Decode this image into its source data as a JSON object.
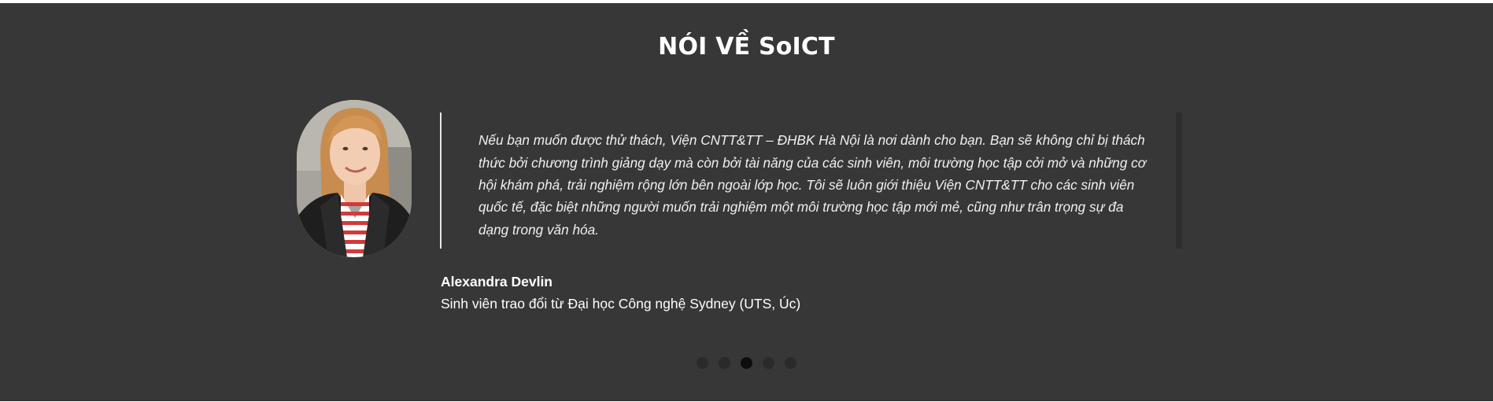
{
  "section": {
    "title": "NÓI VỀ SoICT",
    "background": "#373737"
  },
  "testimonial": {
    "quote": "Nếu bạn muốn được thử thách, Viện CNTT&TT – ĐHBK Hà Nội là nơi dành cho bạn. Bạn sẽ không chỉ bị thách thức bởi chương trình giảng dạy mà còn bởi tài năng của các sinh viên, môi trường học tập cởi mở và những cơ hội khám phá, trải nghiệm rộng lớn bên ngoài lớp học. Tôi sẽ luôn giới thiệu Viện CNTT&TT cho các sinh viên quốc tế, đặc biệt những người muốn trải nghiệm một môi trường học tập mới mẻ, cũng như trân trọng sự đa dạng trong văn hóa.",
    "author_name": "Alexandra Devlin",
    "author_role": "Sinh viên trao đổi từ Đại học Công nghệ Sydney (UTS, Úc)",
    "photo": "student-portrait-photo"
  },
  "carousel": {
    "slide_count": 5,
    "active_index": 2
  }
}
